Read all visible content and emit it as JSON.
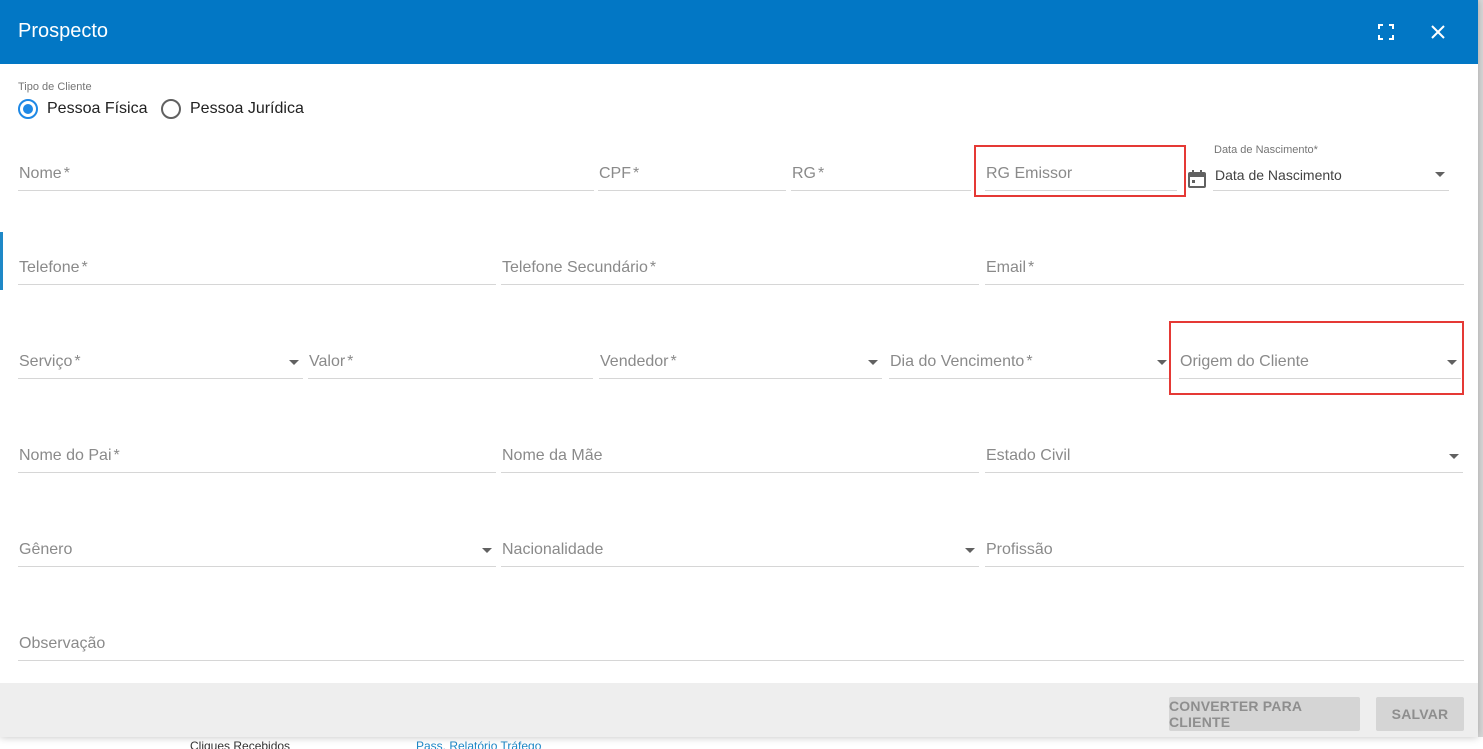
{
  "dialog": {
    "title": "Prospecto"
  },
  "customer_type": {
    "label": "Tipo de Cliente",
    "options": [
      {
        "label": "Pessoa Física",
        "selected": true
      },
      {
        "label": "Pessoa Jurídica",
        "selected": false
      }
    ]
  },
  "fields": {
    "nome": "Nome",
    "cpf": "CPF",
    "rg": "RG",
    "rg_emissor": "RG Emissor",
    "data_nascimento_label": "Data de Nascimento",
    "data_nascimento_value": "Data de Nascimento",
    "telefone": "Telefone",
    "telefone_secundario": "Telefone Secundário",
    "email": "Email",
    "servico": "Serviço",
    "valor": "Valor",
    "vendedor": "Vendedor",
    "dia_vencimento": "Dia do Vencimento",
    "origem_cliente": "Origem do Cliente",
    "nome_pai": "Nome do Pai",
    "nome_mae": "Nome da Mãe",
    "estado_civil": "Estado Civil",
    "genero": "Gênero",
    "nacionalidade": "Nacionalidade",
    "profissao": "Profissão",
    "observacao": "Observação",
    "required_mark": "*"
  },
  "footer": {
    "convert_label": "CONVERTER PARA CLIENTE",
    "save_label": "SALVAR"
  },
  "background": {
    "text_left": "Cliques Recebidos",
    "text_link": "Pass. Relatório Tráfego"
  },
  "colors": {
    "header": "#0277c5",
    "radio_selected": "#1e88e5",
    "highlight": "#e53935"
  }
}
